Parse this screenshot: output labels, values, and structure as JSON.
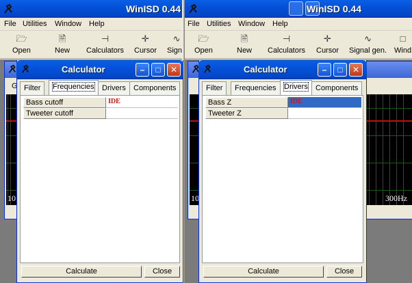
{
  "app": {
    "title": "WinISD 0.44",
    "menu": [
      "File",
      "Utilities",
      "Window",
      "Help"
    ],
    "toolbar_left": [
      "Open",
      "New",
      "Calculators",
      "Cursor",
      "Signa"
    ],
    "toolbar_right": [
      "Open",
      "New",
      "Calculators",
      "Cursor",
      "Signal gen.",
      "Wind"
    ],
    "graph_left_label": "10",
    "graph_right_label": "10",
    "graph_right_freq": "300Hz",
    "child_tab_fragment": "G"
  },
  "dialog_left": {
    "title": "Calculator",
    "tabs": [
      "Filter",
      "Frequencies",
      "Drivers",
      "Components"
    ],
    "active_tab": "Frequencies",
    "rows": [
      {
        "label": "Bass cutoff",
        "value": "IDE"
      },
      {
        "label": "Tweeter cutoff",
        "value": ""
      }
    ],
    "calculate_label": "Calculate",
    "close_label": "Close"
  },
  "dialog_right": {
    "title": "Calculator",
    "tabs": [
      "Filter",
      "Frequencies",
      "Drivers",
      "Components"
    ],
    "active_tab": "Drivers",
    "rows": [
      {
        "label": "Bass Z",
        "value": "IDE"
      },
      {
        "label": "Tweeter Z",
        "value": ""
      }
    ],
    "calculate_label": "Calculate",
    "close_label": "Close"
  },
  "colors": {
    "titlebar": "#0451d8",
    "selection": "#316ac5",
    "value_text": "#e01010",
    "graph_bg": "#000000",
    "graph_line": "#c01010"
  },
  "icons": [
    "app-icon",
    "open-folder-icon",
    "new-document-icon",
    "calculators-icon",
    "cursor-crosshair-icon",
    "signal-gen-icon",
    "minimize-icon",
    "maximize-icon",
    "close-icon"
  ]
}
